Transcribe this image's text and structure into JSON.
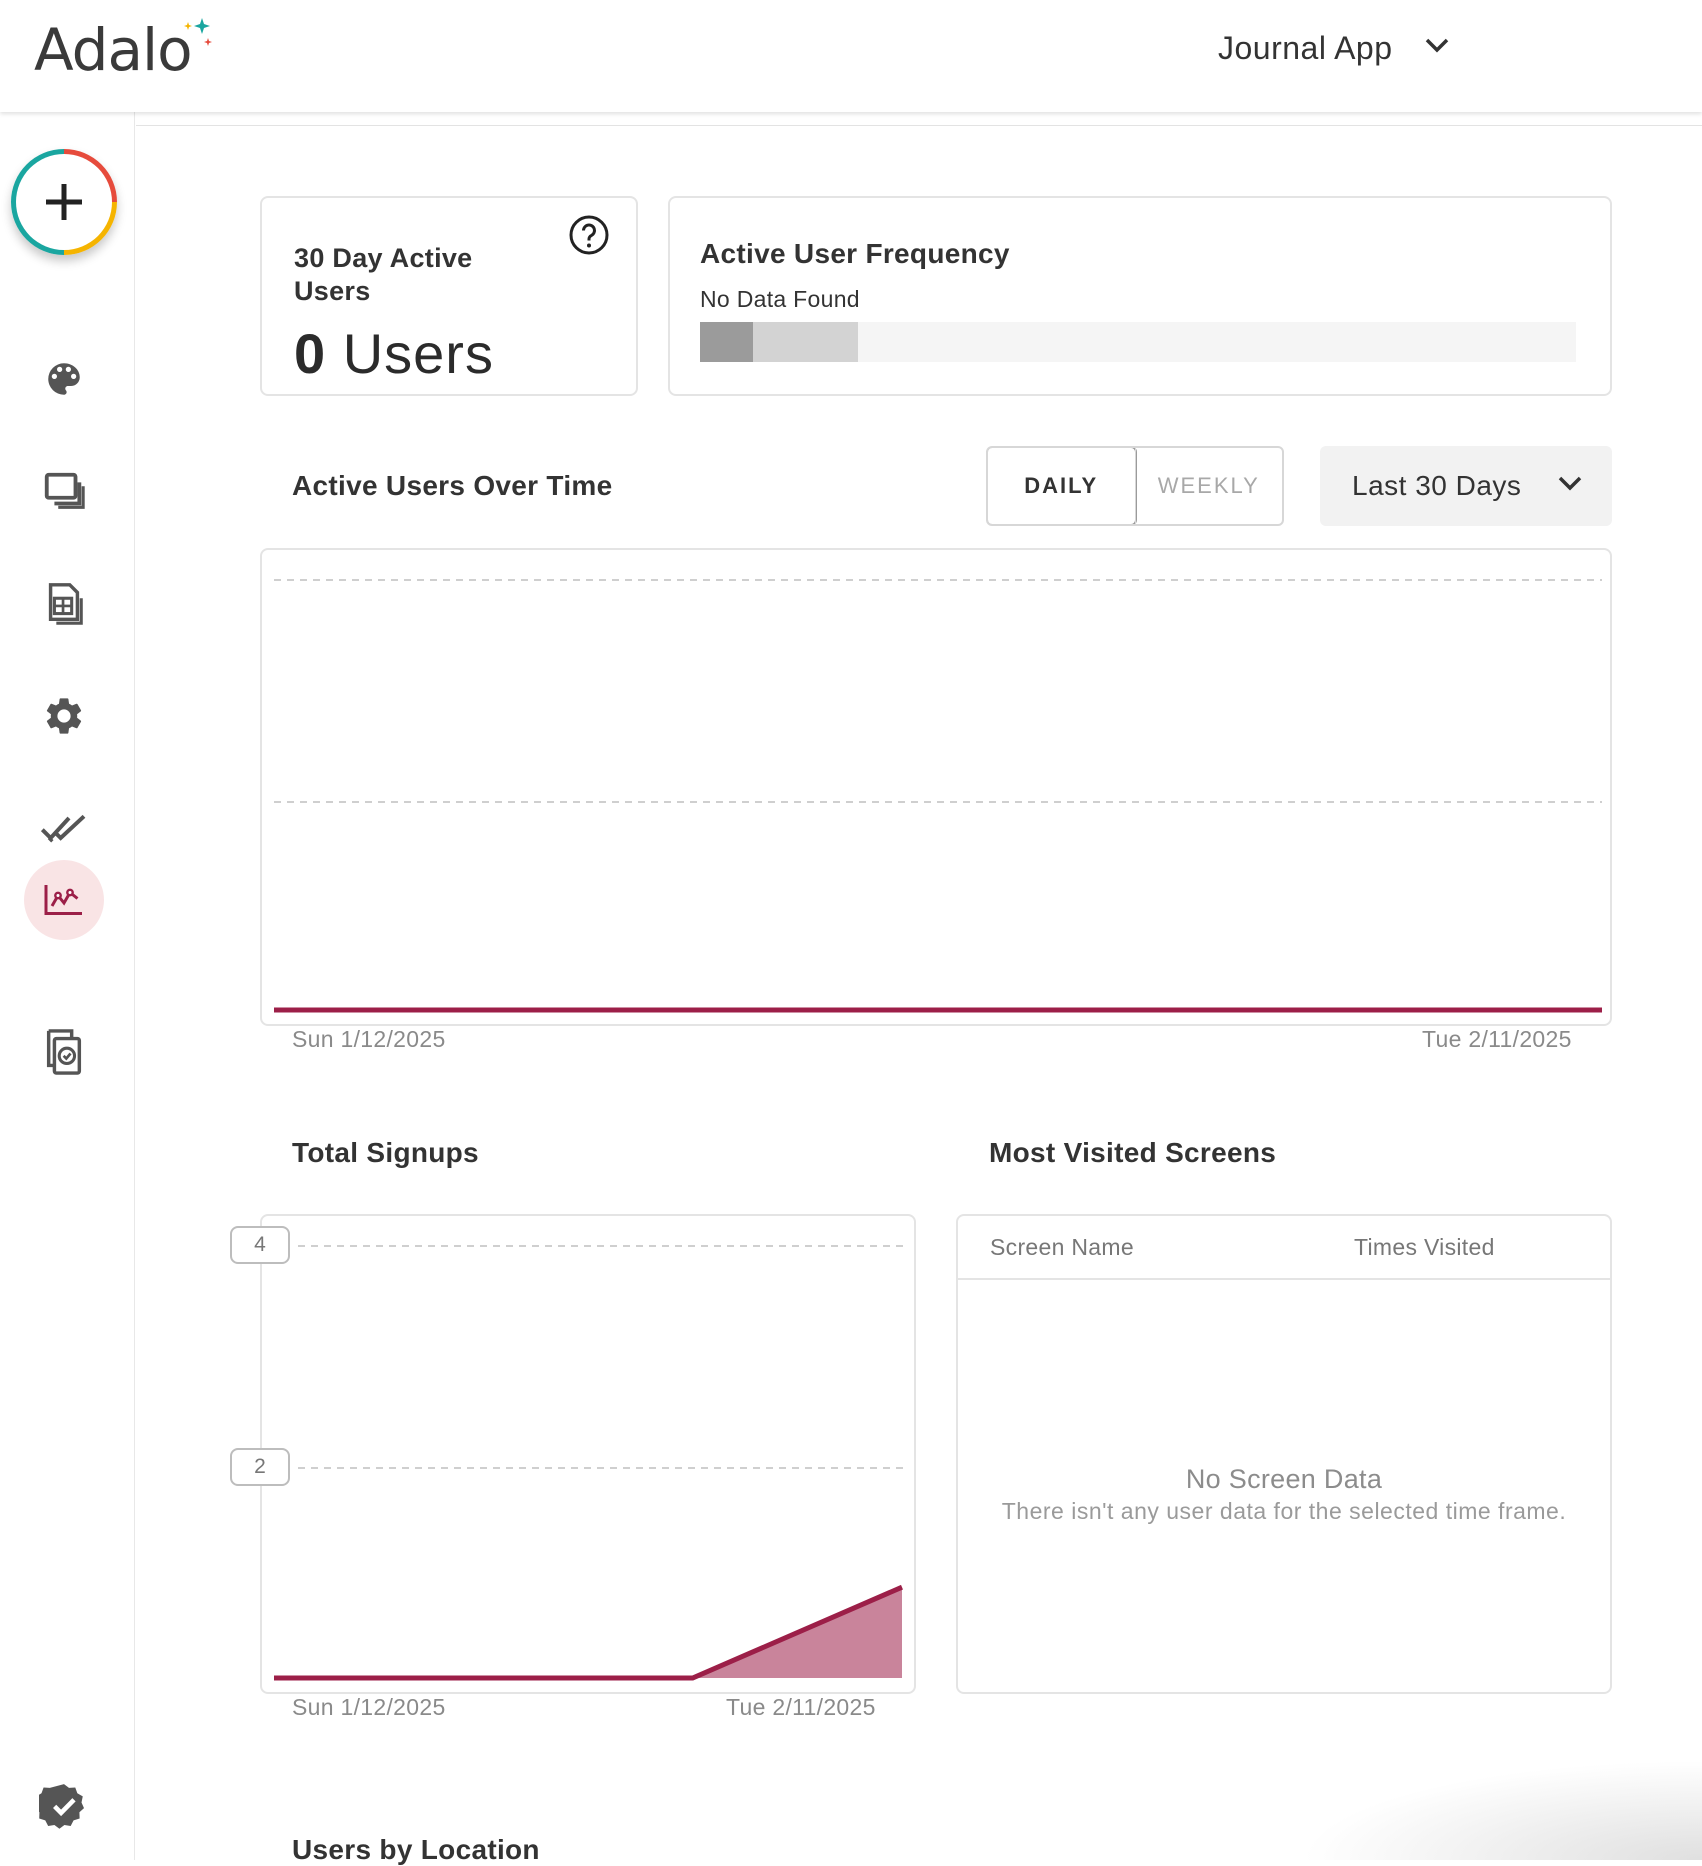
{
  "header": {
    "logo_text": "Adalo",
    "app_name": "Journal App"
  },
  "sidebar": {
    "items": [
      {
        "name": "add-button",
        "icon": "plus-icon"
      },
      {
        "name": "branding",
        "icon": "palette-icon"
      },
      {
        "name": "screens",
        "icon": "screens-icon"
      },
      {
        "name": "database",
        "icon": "database-icon"
      },
      {
        "name": "settings",
        "icon": "gear-icon"
      },
      {
        "name": "publish",
        "icon": "double-check-icon"
      },
      {
        "name": "analytics",
        "icon": "analytics-icon",
        "active": true
      },
      {
        "name": "versions",
        "icon": "versions-icon"
      },
      {
        "name": "status",
        "icon": "verified-badge-icon"
      }
    ]
  },
  "colors": {
    "accent": "#9c1f48",
    "active_nav_bg": "#f9e4e5",
    "card_border": "#e4e4e4"
  },
  "active_users_card": {
    "title": "30 Day Active Users",
    "value_number": "0",
    "value_unit": "Users"
  },
  "frequency_card": {
    "title": "Active User Frequency",
    "status": "No Data Found",
    "segments": [
      {
        "color": "#9b9b9b",
        "fraction": 0.06
      },
      {
        "color": "#d3d3d3",
        "fraction": 0.12
      }
    ]
  },
  "active_over_time": {
    "title": "Active Users Over Time",
    "toggle": {
      "daily": "DAILY",
      "weekly": "WEEKLY",
      "selected": "DAILY"
    },
    "range": "Last 30 Days",
    "x_start": "Sun 1/12/2025",
    "x_end": "Tue 2/11/2025"
  },
  "total_signups": {
    "title": "Total Signups",
    "y_ticks": [
      "4",
      "2"
    ],
    "x_start": "Sun 1/12/2025",
    "x_end": "Tue 2/11/2025"
  },
  "most_visited": {
    "title": "Most Visited Screens",
    "columns": [
      "Screen Name",
      "Times Visited"
    ],
    "empty_title": "No Screen Data",
    "empty_message": "There isn't any user data for the selected time frame."
  },
  "users_by_location": {
    "title": "Users by Location"
  },
  "chart_data": [
    {
      "type": "area",
      "title": "Active Users Over Time",
      "x": [
        "Sun 1/12/2025",
        "Tue 2/11/2025"
      ],
      "series": [
        {
          "values": [
            0,
            0
          ]
        }
      ],
      "grid": true
    },
    {
      "type": "area",
      "title": "Total Signups",
      "x": [
        "Sun 1/12/2025",
        "Tue 2/11/2025"
      ],
      "y_ticks": [
        2,
        4
      ],
      "ylim": [
        0,
        5
      ],
      "series": [
        {
          "values": [
            0,
            0,
            0,
            1
          ]
        }
      ],
      "grid": true
    }
  ]
}
